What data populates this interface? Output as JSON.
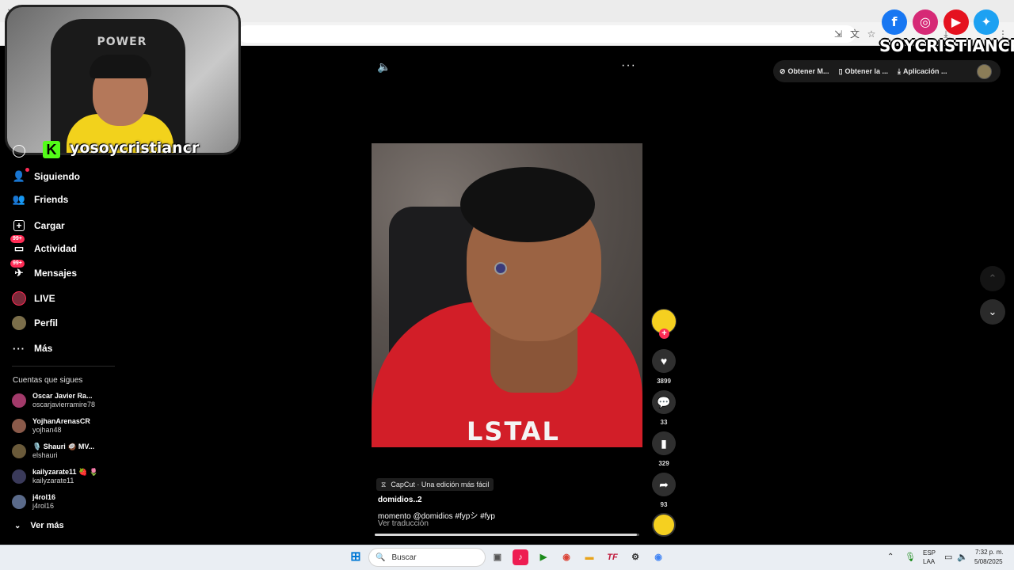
{
  "browser": {
    "toolbar_icons": [
      "install-icon",
      "translate-icon",
      "bookmark-star-icon",
      "extensions-icon",
      "download-icon",
      "profile-icon",
      "menu-icon"
    ]
  },
  "webcam": {
    "chair_logo": "POWER",
    "streamer_name": "yosoycristiancr",
    "platform_logo": "K"
  },
  "social_overlay": {
    "icons": [
      "facebook-icon",
      "instagram-icon",
      "youtube-icon",
      "twitter-icon"
    ],
    "name": "SOYCRISTIANCR"
  },
  "sidebar": {
    "items": [
      {
        "label": "Siguiendo",
        "icon": "following-icon"
      },
      {
        "label": "Friends",
        "icon": "friends-icon"
      },
      {
        "label": "Cargar",
        "icon": "upload-icon"
      },
      {
        "label": "Actividad",
        "icon": "activity-icon",
        "badge": "99+"
      },
      {
        "label": "Mensajes",
        "icon": "messages-icon",
        "badge": "99+"
      },
      {
        "label": "LIVE",
        "icon": "live-icon"
      },
      {
        "label": "Perfil",
        "icon": "profile-avatar"
      },
      {
        "label": "Más",
        "icon": "more-icon"
      }
    ],
    "following_header": "Cuentas que sigues",
    "accounts": [
      {
        "name": "Oscar Javier Ra...",
        "handle": "oscarjavierramire78"
      },
      {
        "name": "YojhanArenasCR",
        "handle": "yojhan48"
      },
      {
        "name": "🎙️ Shauri 🥥 MV...",
        "handle": "elshauri"
      },
      {
        "name": "kailyzarate11 🍓 🌷",
        "handle": "kailyzarate11"
      },
      {
        "name": "j4rol16",
        "handle": "j4rol16"
      }
    ],
    "see_more": "Ver más"
  },
  "video": {
    "capcut_tag": "CapCut · Una edición más fácil",
    "author": "domidios..2",
    "description": "momento @domidios  #fypシ  #fyp",
    "translate": "Ver traducción",
    "shirt_text": "LSTAL",
    "progress": 0.99
  },
  "actions": {
    "likes": "3899",
    "comments": "33",
    "saves": "329",
    "shares": "93"
  },
  "topright": {
    "items": [
      "Obtener M...",
      "Obtener la ...",
      "Aplicación ..."
    ]
  },
  "taskbar": {
    "search_placeholder": "Buscar",
    "lang_top": "ESP",
    "lang_bottom": "LAA",
    "time": "7:32 p. m.",
    "date": "5/08/2025"
  },
  "colors": {
    "accent": "#fe2c55",
    "kick_green": "#53fc18",
    "background": "#000000"
  }
}
